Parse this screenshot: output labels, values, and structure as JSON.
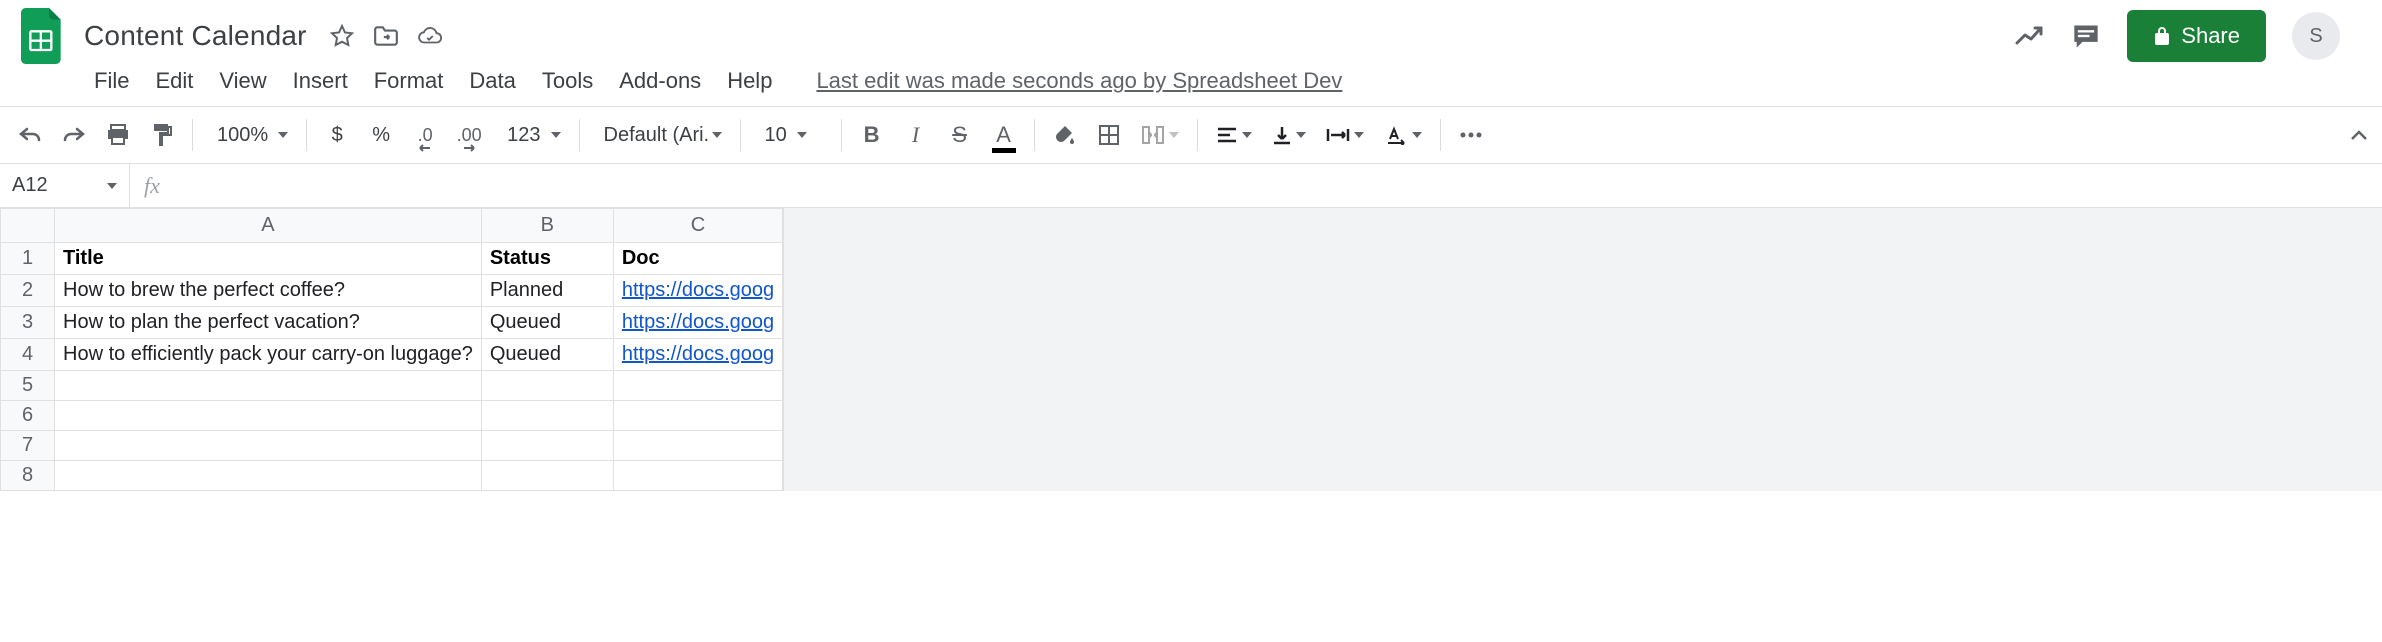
{
  "header": {
    "doc_title": "Content Calendar",
    "avatar_initial": "S",
    "share_label": "Share",
    "last_edit": "Last edit was made seconds ago by Spreadsheet Dev"
  },
  "menu": {
    "items": [
      "File",
      "Edit",
      "View",
      "Insert",
      "Format",
      "Data",
      "Tools",
      "Add-ons",
      "Help"
    ]
  },
  "toolbar": {
    "zoom": "100%",
    "currency": "$",
    "percent": "%",
    "dec_dec": ".0",
    "inc_dec": ".00",
    "more_formats": "123",
    "font": "Default (Ari...",
    "font_size": "10"
  },
  "name_box": "A12",
  "columns": [
    "A",
    "B",
    "C"
  ],
  "header_row": {
    "title": "Title",
    "status": "Status",
    "doc": "Doc"
  },
  "rows": [
    {
      "title": "How to brew the perfect coffee?",
      "status": "Planned",
      "doc": "https://docs.goog"
    },
    {
      "title": "How to plan the perfect vacation?",
      "status": "Queued",
      "doc": "https://docs.goog"
    },
    {
      "title": "How to efficiently pack your carry-on luggage?",
      "status": "Queued",
      "doc": "https://docs.goog"
    }
  ],
  "empty_row_count": 4,
  "row_numbers": [
    "1",
    "2",
    "3",
    "4",
    "5",
    "6",
    "7",
    "8"
  ]
}
